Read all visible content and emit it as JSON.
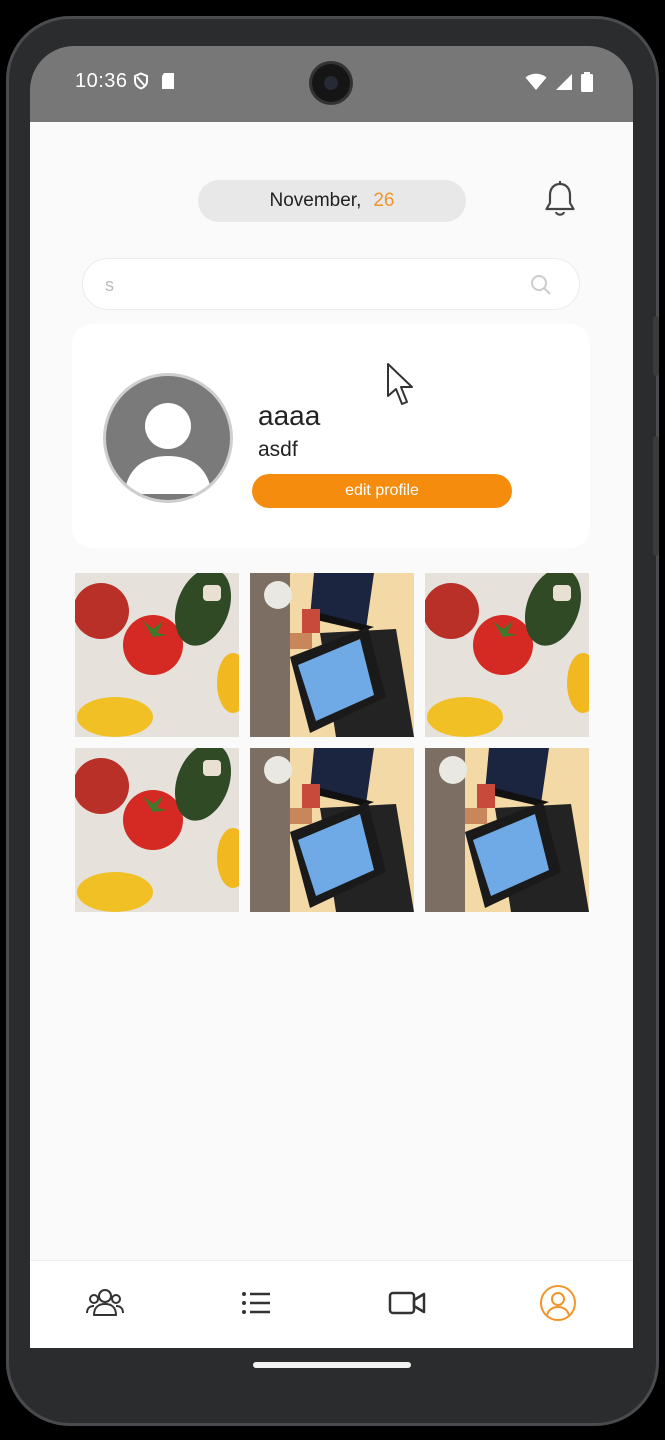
{
  "status_bar": {
    "time": "10:36"
  },
  "header": {
    "date_month": "November,",
    "date_day": "26"
  },
  "search": {
    "value": "s"
  },
  "profile": {
    "name": "aaaa",
    "handle": "asdf",
    "edit_button_label": "edit profile"
  },
  "gallery": {
    "photos": [
      {
        "subject": "vegetables"
      },
      {
        "subject": "laptop-desk"
      },
      {
        "subject": "vegetables"
      },
      {
        "subject": "vegetables"
      },
      {
        "subject": "laptop-desk"
      },
      {
        "subject": "laptop-desk"
      }
    ]
  },
  "bottom_nav": {
    "items": [
      {
        "icon": "group-icon"
      },
      {
        "icon": "list-icon"
      },
      {
        "icon": "video-camera-icon"
      },
      {
        "icon": "profile-icon",
        "active": true
      }
    ]
  },
  "colors": {
    "accent": "#f68c0e",
    "date_day": "#f0952c",
    "status_bar": "#777777",
    "background": "#fafafa"
  }
}
